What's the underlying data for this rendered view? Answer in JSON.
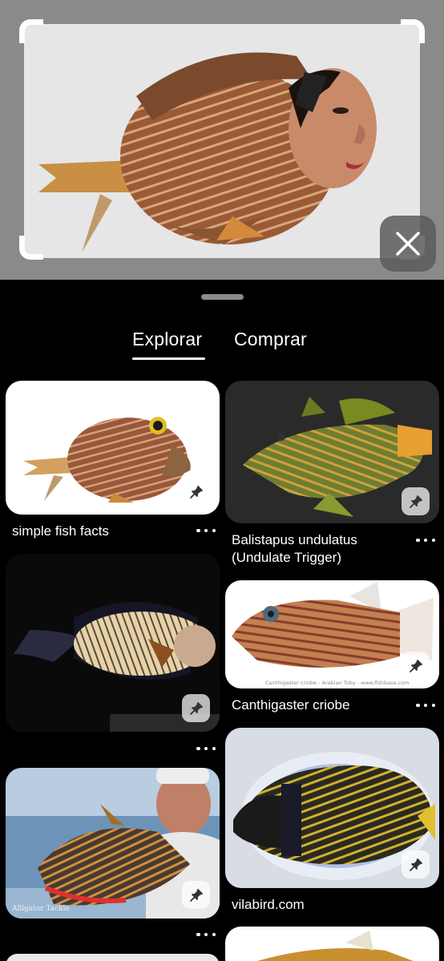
{
  "query": {
    "image_alt": "Fish with a human face (cropped search image)",
    "close_icon": "close-icon"
  },
  "tabs": [
    {
      "label": "Explorar",
      "active": true
    },
    {
      "label": "Comprar",
      "active": false
    }
  ],
  "pins": [
    {
      "title": "simple fish facts",
      "icon": "pin-icon"
    },
    {
      "title": "Balistapus undulatus (Undulate Trigger)",
      "icon": "pin-icon"
    },
    {
      "title": "",
      "icon": "pin-icon"
    },
    {
      "title": "Canthigaster criobe",
      "icon": "pin-icon"
    },
    {
      "title": "",
      "icon": "pin-icon"
    },
    {
      "title": "vilabird.com",
      "icon": "pin-icon"
    }
  ],
  "colors": {
    "background": "#000000",
    "query_backdrop": "#8a8a8a",
    "text": "#ffffff"
  }
}
